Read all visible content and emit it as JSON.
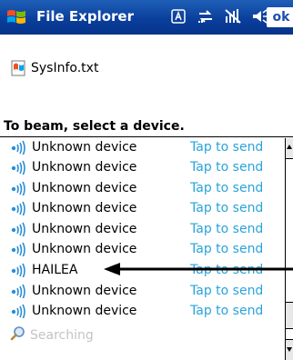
{
  "titlebar": {
    "app_title": "File Explorer",
    "ok_label": "ok",
    "icons": [
      "start-icon",
      "keyboard-indicator-icon",
      "connectivity-icon",
      "signal-off-icon",
      "volume-icon"
    ]
  },
  "file": {
    "name": "SysInfo.txt",
    "icon": "text-file-icon"
  },
  "beam": {
    "title": "To beam, select a device.",
    "devices": [
      {
        "name": "Unknown device",
        "action": "Tap to send"
      },
      {
        "name": "Unknown device",
        "action": "Tap to send"
      },
      {
        "name": "Unknown device",
        "action": "Tap to send"
      },
      {
        "name": "Unknown device",
        "action": "Tap to send"
      },
      {
        "name": "Unknown device",
        "action": "Tap to send"
      },
      {
        "name": "Unknown device",
        "action": "Tap to send"
      },
      {
        "name": "HAILEA",
        "action": "Tap to send"
      },
      {
        "name": "Unknown device",
        "action": "Tap to send"
      },
      {
        "name": "Unknown device",
        "action": "Tap to send"
      }
    ],
    "searching_text": "Searching"
  },
  "colors": {
    "titlebar": "#0a3f9c",
    "action_link": "#29a4d9",
    "searching_text": "#c4c4c4"
  }
}
